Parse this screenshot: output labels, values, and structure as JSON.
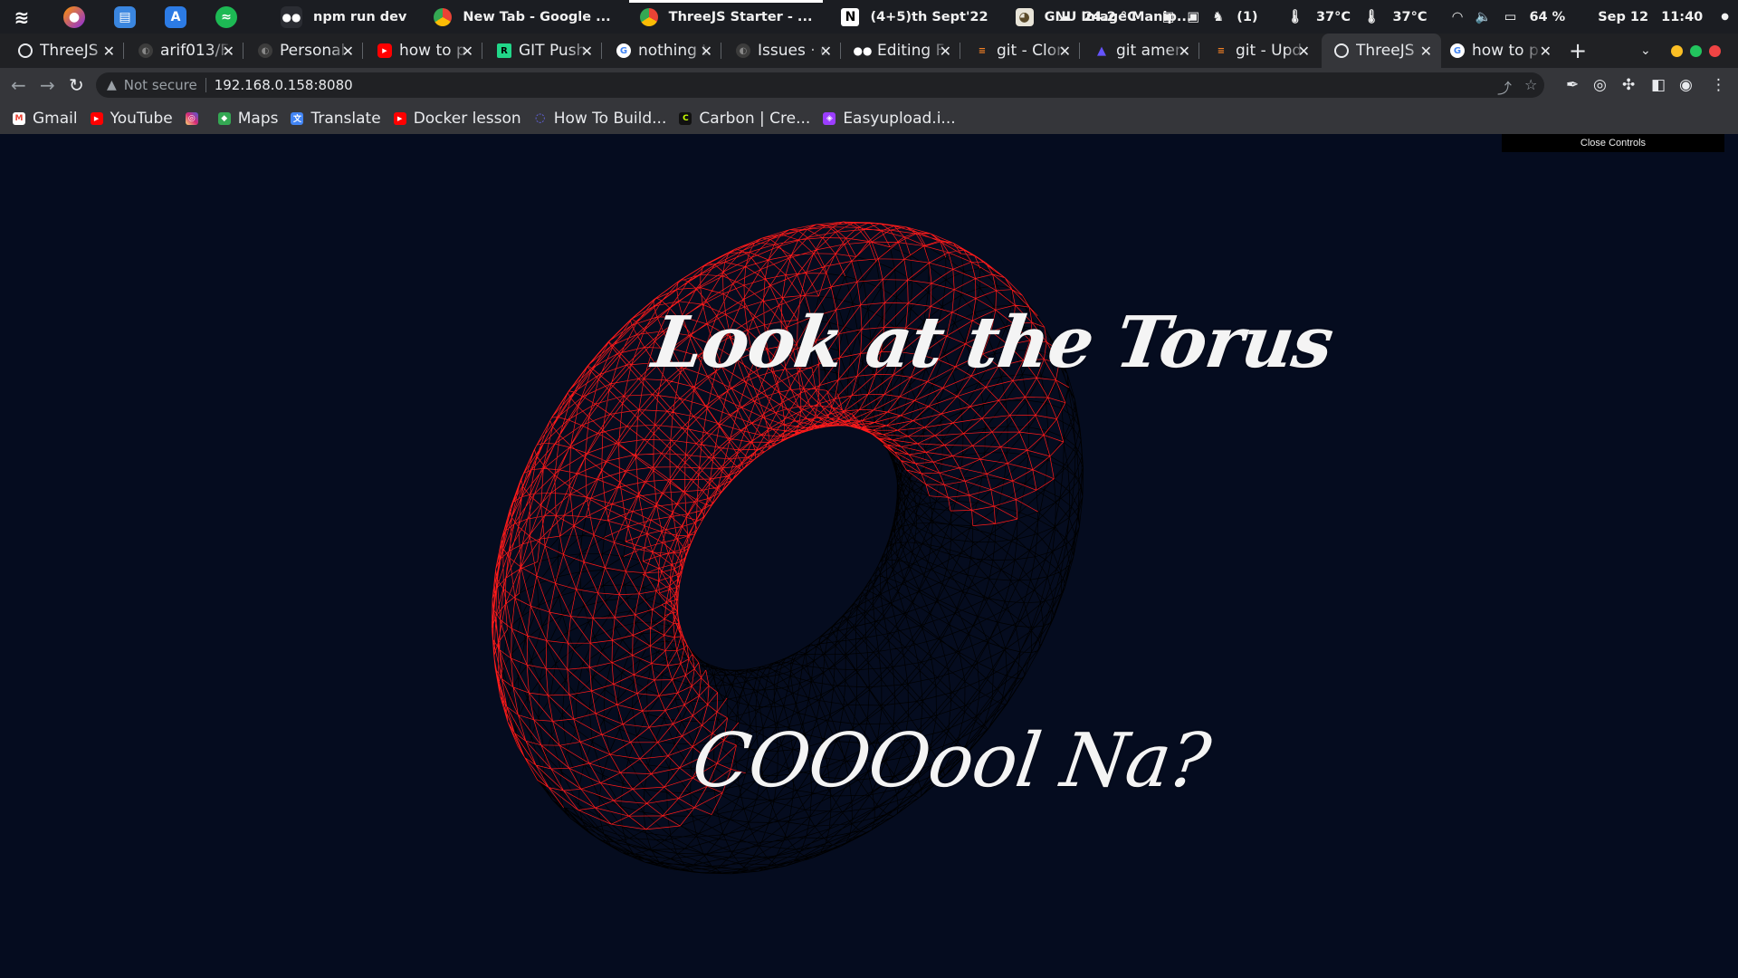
{
  "os_bar": {
    "apps": [
      {
        "label": "npm run dev",
        "icon": "terminal-icon"
      },
      {
        "label": "New Tab - Google ...",
        "icon": "chrome-icon"
      },
      {
        "label": "ThreeJS Starter - ...",
        "icon": "chrome-icon",
        "active": true
      },
      {
        "label": "(4+5)th Sept'22",
        "icon": "notion-icon"
      },
      {
        "label": "GNU Image Manip...",
        "icon": "gimp-icon"
      }
    ],
    "weather": "24.2 °C",
    "counter": "(1)",
    "temp_1": "37°C",
    "temp_2": "37°C",
    "battery": "64 %",
    "date": "Sep 12",
    "time": "11:40"
  },
  "tabs": [
    {
      "label": "ThreeJS",
      "icon": "globe-icon"
    },
    {
      "label": "arif013/F",
      "icon": "github-icon"
    },
    {
      "label": "Personal",
      "icon": "github-icon"
    },
    {
      "label": "how to p",
      "icon": "youtube-icon"
    },
    {
      "label": "GIT Push",
      "icon": "pycharm-icon"
    },
    {
      "label": "nothing t",
      "icon": "google-icon"
    },
    {
      "label": "Issues · d",
      "icon": "github-icon"
    },
    {
      "label": "Editing F",
      "icon": "medium-icon"
    },
    {
      "label": "git - Clon",
      "icon": "stackoverflow-icon"
    },
    {
      "label": "git amen",
      "icon": "atlassian-icon"
    },
    {
      "label": "git - Upd",
      "icon": "stackoverflow-icon"
    },
    {
      "label": "ThreeJS",
      "icon": "globe-icon",
      "active": true
    },
    {
      "label": "how to p",
      "icon": "google-icon"
    }
  ],
  "toolbar": {
    "security_label": "Not secure",
    "url": "192.168.0.158:8080"
  },
  "bookmarks": [
    {
      "label": "Gmail",
      "icon": "gmail-icon"
    },
    {
      "label": "YouTube",
      "icon": "youtube-icon"
    },
    {
      "label": "",
      "icon": "instagram-icon"
    },
    {
      "label": "Maps",
      "icon": "maps-icon"
    },
    {
      "label": "Translate",
      "icon": "translate-icon"
    },
    {
      "label": "Docker lesson",
      "icon": "youtube-icon"
    },
    {
      "label": "How To Build...",
      "icon": "loop-icon"
    },
    {
      "label": "Carbon | Cre...",
      "icon": "carbon-icon"
    },
    {
      "label": "Easyupload.i...",
      "icon": "easyupload-icon"
    }
  ],
  "page": {
    "controls_label": "Close Controls",
    "title": "Look at the Torus",
    "subtitle": "COOOool Na?",
    "colors": {
      "background": "#050c1f",
      "torus_front": "#ff1a1a",
      "torus_back": "#000000"
    }
  }
}
